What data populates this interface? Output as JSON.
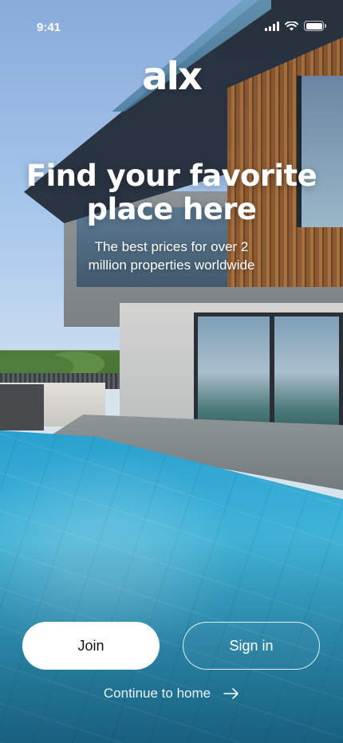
{
  "status_bar": {
    "time": "9:41"
  },
  "brand": {
    "logo_text": "alx"
  },
  "hero": {
    "headline_line1": "Find your favorite",
    "headline_line2": "place here",
    "subtitle_line1": "The best prices for over 2",
    "subtitle_line2": "million properties worldwide"
  },
  "actions": {
    "join_label": "Join",
    "signin_label": "Sign in",
    "continue_label": "Continue to home"
  },
  "icons": {
    "status": [
      "signal-icon",
      "wifi-icon",
      "battery-icon"
    ],
    "continue": "arrow-right-icon"
  },
  "colors": {
    "primary_button_bg": "#ffffff",
    "primary_button_text": "#111111",
    "text": "#ffffff"
  }
}
